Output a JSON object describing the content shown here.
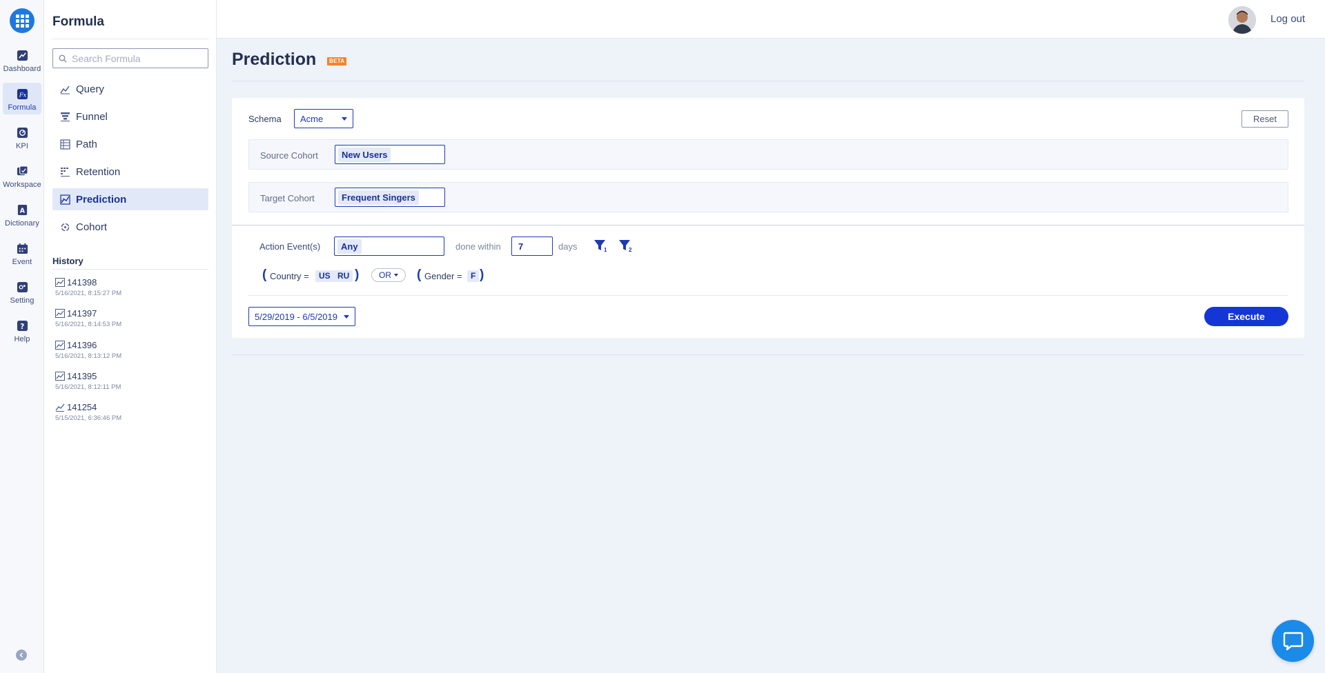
{
  "rail": {
    "items": [
      {
        "label": "Dashboard",
        "icon": "dashboard-icon"
      },
      {
        "label": "Formula",
        "icon": "formula-icon",
        "active": true
      },
      {
        "label": "KPI",
        "icon": "kpi-icon"
      },
      {
        "label": "Workspace",
        "icon": "workspace-icon"
      },
      {
        "label": "Dictionary",
        "icon": "dictionary-icon"
      },
      {
        "label": "Event",
        "icon": "calendar-icon"
      },
      {
        "label": "Setting",
        "icon": "gear-icon"
      },
      {
        "label": "Help",
        "icon": "help-icon"
      }
    ]
  },
  "sidebar": {
    "title": "Formula",
    "search_placeholder": "Search Formula",
    "nav": [
      {
        "label": "Query",
        "icon": "query-icon"
      },
      {
        "label": "Funnel",
        "icon": "funnel-icon"
      },
      {
        "label": "Path",
        "icon": "path-icon"
      },
      {
        "label": "Retention",
        "icon": "retention-icon"
      },
      {
        "label": "Prediction",
        "icon": "prediction-icon",
        "active": true
      },
      {
        "label": "Cohort",
        "icon": "cohort-icon"
      }
    ],
    "history_title": "History",
    "history": [
      {
        "id": "141398",
        "time": "5/16/2021, 8:15:27 PM"
      },
      {
        "id": "141397",
        "time": "5/16/2021, 8:14:53 PM"
      },
      {
        "id": "141396",
        "time": "5/16/2021, 8:13:12 PM"
      },
      {
        "id": "141395",
        "time": "5/16/2021, 8:12:11 PM"
      },
      {
        "id": "141254",
        "time": "5/15/2021, 6:36:46 PM"
      }
    ]
  },
  "topbar": {
    "logout_label": "Log out"
  },
  "page": {
    "title": "Prediction",
    "badge": "BETA"
  },
  "form": {
    "schema_label": "Schema",
    "schema_value": "Acme",
    "reset_label": "Reset",
    "source_cohort_label": "Source Cohort",
    "source_cohort_value": "New Users",
    "target_cohort_label": "Target Cohort",
    "target_cohort_value": "Frequent Singers",
    "action_events_label": "Action Event(s)",
    "action_events_value": "Any",
    "done_within_label": "done within",
    "days_value": "7",
    "days_label": "days",
    "filter1_sub": "1",
    "filter2_sub": "2",
    "condition1": {
      "open": "(",
      "field": "Country =",
      "values": [
        "US",
        "RU"
      ],
      "close": ")"
    },
    "operator": "OR",
    "condition2": {
      "open": "(",
      "field": "Gender =",
      "values": [
        "F"
      ],
      "close": ")"
    },
    "date_range": "5/29/2019 - 6/5/2019",
    "execute_label": "Execute"
  },
  "colors": {
    "accent": "#1436d6",
    "beta": "#f5822a",
    "chat": "#1a8be8"
  }
}
